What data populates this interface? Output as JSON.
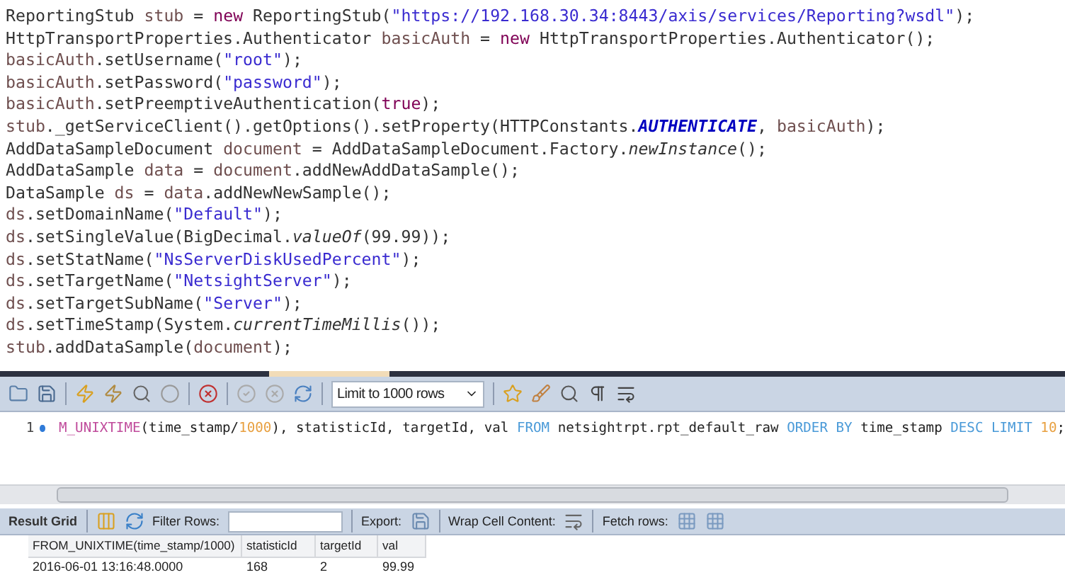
{
  "code_lines": [
    [
      {
        "kind": "plain",
        "text": "ReportingStub "
      },
      {
        "kind": "var",
        "text": "stub"
      },
      {
        "kind": "plain",
        "text": " = "
      },
      {
        "kind": "keyword",
        "text": "new"
      },
      {
        "kind": "plain",
        "text": " ReportingStub("
      },
      {
        "kind": "string",
        "text": "\"https://192.168.30.34:8443/axis/services/Reporting?wsdl\""
      },
      {
        "kind": "plain",
        "text": ");"
      }
    ],
    [
      {
        "kind": "plain",
        "text": "HttpTransportProperties.Authenticator "
      },
      {
        "kind": "var",
        "text": "basicAuth"
      },
      {
        "kind": "plain",
        "text": " = "
      },
      {
        "kind": "keyword",
        "text": "new"
      },
      {
        "kind": "plain",
        "text": " HttpTransportProperties.Authenticator();"
      }
    ],
    [
      {
        "kind": "var",
        "text": "basicAuth"
      },
      {
        "kind": "plain",
        "text": ".setUsername("
      },
      {
        "kind": "string",
        "text": "\"root\""
      },
      {
        "kind": "plain",
        "text": ");"
      }
    ],
    [
      {
        "kind": "var",
        "text": "basicAuth"
      },
      {
        "kind": "plain",
        "text": ".setPassword("
      },
      {
        "kind": "string",
        "text": "\"password\""
      },
      {
        "kind": "plain",
        "text": ");"
      }
    ],
    [
      {
        "kind": "var",
        "text": "basicAuth"
      },
      {
        "kind": "plain",
        "text": ".setPreemptiveAuthentication("
      },
      {
        "kind": "keyword",
        "text": "true"
      },
      {
        "kind": "plain",
        "text": ");"
      }
    ],
    [
      {
        "kind": "var",
        "text": "stub"
      },
      {
        "kind": "plain",
        "text": "._getServiceClient().getOptions().setProperty(HTTPConstants."
      },
      {
        "kind": "const",
        "text": "AUTHENTICATE"
      },
      {
        "kind": "plain",
        "text": ", "
      },
      {
        "kind": "var",
        "text": "basicAuth"
      },
      {
        "kind": "plain",
        "text": ");"
      }
    ],
    [
      {
        "kind": "plain",
        "text": "AddDataSampleDocument "
      },
      {
        "kind": "var",
        "text": "document"
      },
      {
        "kind": "plain",
        "text": " = AddDataSampleDocument.Factory."
      },
      {
        "kind": "static",
        "text": "newInstance"
      },
      {
        "kind": "plain",
        "text": "();"
      }
    ],
    [
      {
        "kind": "plain",
        "text": "AddDataSample "
      },
      {
        "kind": "var",
        "text": "data"
      },
      {
        "kind": "plain",
        "text": " = "
      },
      {
        "kind": "var",
        "text": "document"
      },
      {
        "kind": "plain",
        "text": ".addNewAddDataSample();"
      }
    ],
    [
      {
        "kind": "plain",
        "text": "DataSample "
      },
      {
        "kind": "var",
        "text": "ds"
      },
      {
        "kind": "plain",
        "text": " = "
      },
      {
        "kind": "var",
        "text": "data"
      },
      {
        "kind": "plain",
        "text": ".addNewNewSample();"
      }
    ],
    [
      {
        "kind": "var",
        "text": "ds"
      },
      {
        "kind": "plain",
        "text": ".setDomainName("
      },
      {
        "kind": "string",
        "text": "\"Default\""
      },
      {
        "kind": "plain",
        "text": ");"
      }
    ],
    [
      {
        "kind": "var",
        "text": "ds"
      },
      {
        "kind": "plain",
        "text": ".setSingleValue(BigDecimal."
      },
      {
        "kind": "static",
        "text": "valueOf"
      },
      {
        "kind": "plain",
        "text": "(99.99));"
      }
    ],
    [
      {
        "kind": "var",
        "text": "ds"
      },
      {
        "kind": "plain",
        "text": ".setStatName("
      },
      {
        "kind": "string",
        "text": "\"NsServerDiskUsedPercent\""
      },
      {
        "kind": "plain",
        "text": ");"
      }
    ],
    [
      {
        "kind": "var",
        "text": "ds"
      },
      {
        "kind": "plain",
        "text": ".setTargetName("
      },
      {
        "kind": "string",
        "text": "\"NetsightServer\""
      },
      {
        "kind": "plain",
        "text": ");"
      }
    ],
    [
      {
        "kind": "var",
        "text": "ds"
      },
      {
        "kind": "plain",
        "text": ".setTargetSubName("
      },
      {
        "kind": "string",
        "text": "\"Server\""
      },
      {
        "kind": "plain",
        "text": ");"
      }
    ],
    [
      {
        "kind": "var",
        "text": "ds"
      },
      {
        "kind": "plain",
        "text": ".setTimeStamp(System."
      },
      {
        "kind": "static",
        "text": "currentTimeMillis"
      },
      {
        "kind": "plain",
        "text": "());"
      }
    ],
    [
      {
        "kind": "var",
        "text": "stub"
      },
      {
        "kind": "plain",
        "text": ".addDataSample("
      },
      {
        "kind": "var",
        "text": "document"
      },
      {
        "kind": "plain",
        "text": ");"
      }
    ]
  ],
  "query_toolbar": {
    "limit_select": "Limit to 1000 rows"
  },
  "sql_editor": {
    "line_number": "1",
    "tokens": [
      {
        "kind": "fn",
        "text": "M_UNIXTIME"
      },
      {
        "kind": "plain",
        "text": "(time_stamp/"
      },
      {
        "kind": "num",
        "text": "1000"
      },
      {
        "kind": "plain",
        "text": "), statisticId, targetId, val "
      },
      {
        "kind": "kw",
        "text": "FROM"
      },
      {
        "kind": "plain",
        "text": " netsightrpt.rpt_default_raw "
      },
      {
        "kind": "kw",
        "text": "ORDER BY"
      },
      {
        "kind": "plain",
        "text": " time_stamp "
      },
      {
        "kind": "kw",
        "text": "DESC LIMIT"
      },
      {
        "kind": "num",
        "text": " 10"
      },
      {
        "kind": "plain",
        "text": ";"
      }
    ]
  },
  "result_toolbar": {
    "tab": "Result Grid",
    "filter_label": "Filter Rows:",
    "export_label": "Export:",
    "wrap_label": "Wrap Cell Content:",
    "fetch_label": "Fetch rows:"
  },
  "table": {
    "columns": [
      "FROM_UNIXTIME(time_stamp/1000)",
      "statisticId",
      "targetId",
      "val"
    ],
    "rows": [
      [
        "2016-06-01 13:16:48.0000",
        "168",
        "2",
        "99.99"
      ]
    ]
  }
}
